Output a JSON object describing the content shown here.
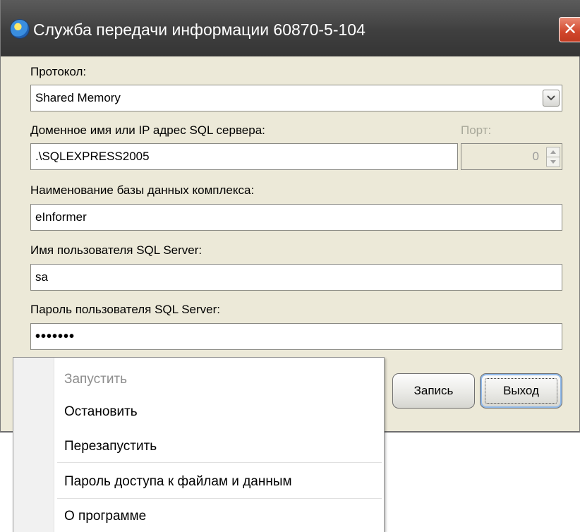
{
  "window": {
    "title": "Служба передачи информации 60870-5-104",
    "close_glyph": "✕"
  },
  "form": {
    "protocol_label": "Протокол:",
    "protocol_value": "Shared Memory",
    "server_label": "Доменное имя или IP адрес SQL сервера:",
    "port_label": "Порт:",
    "server_value": ".\\SQLEXPRESS2005",
    "port_value": "0",
    "database_label": "Наименование базы данных комплекса:",
    "database_value": "eInformer",
    "user_label": "Имя пользователя SQL Server:",
    "user_value": "sa",
    "password_label": "Пароль пользователя SQL Server:",
    "password_mask": "•••••••"
  },
  "buttons": {
    "save_label": "Запись",
    "exit_label": "Выход"
  },
  "context_menu": {
    "items": [
      {
        "label": "Запустить",
        "disabled": true
      },
      {
        "label": "Остановить",
        "disabled": false
      },
      {
        "label": "Перезапустить",
        "disabled": false
      },
      {
        "label": "Пароль доступа к файлам и данным",
        "disabled": false
      },
      {
        "label": "О программе",
        "disabled": false
      }
    ]
  }
}
